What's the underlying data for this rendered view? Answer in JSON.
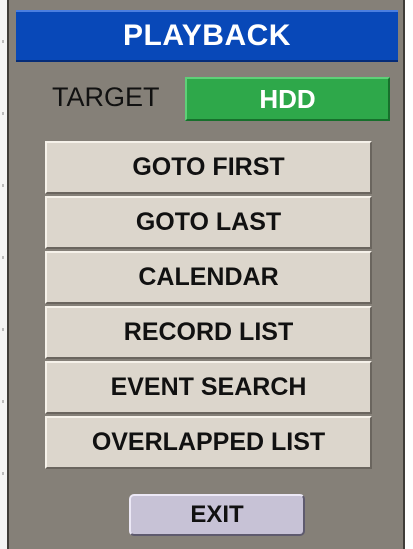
{
  "dialog": {
    "title": "PLAYBACK",
    "title_bar_color": "#0848b8",
    "background_color": "#858078"
  },
  "target": {
    "label": "TARGET",
    "value": "HDD",
    "value_color": "#2ea84a"
  },
  "menu": {
    "items": [
      {
        "label": "GOTO FIRST"
      },
      {
        "label": "GOTO LAST"
      },
      {
        "label": "CALENDAR"
      },
      {
        "label": "RECORD LIST"
      },
      {
        "label": "EVENT SEARCH"
      },
      {
        "label": "OVERLAPPED LIST"
      }
    ]
  },
  "footer": {
    "exit_label": "EXIT",
    "exit_color": "#c7c2d6"
  }
}
